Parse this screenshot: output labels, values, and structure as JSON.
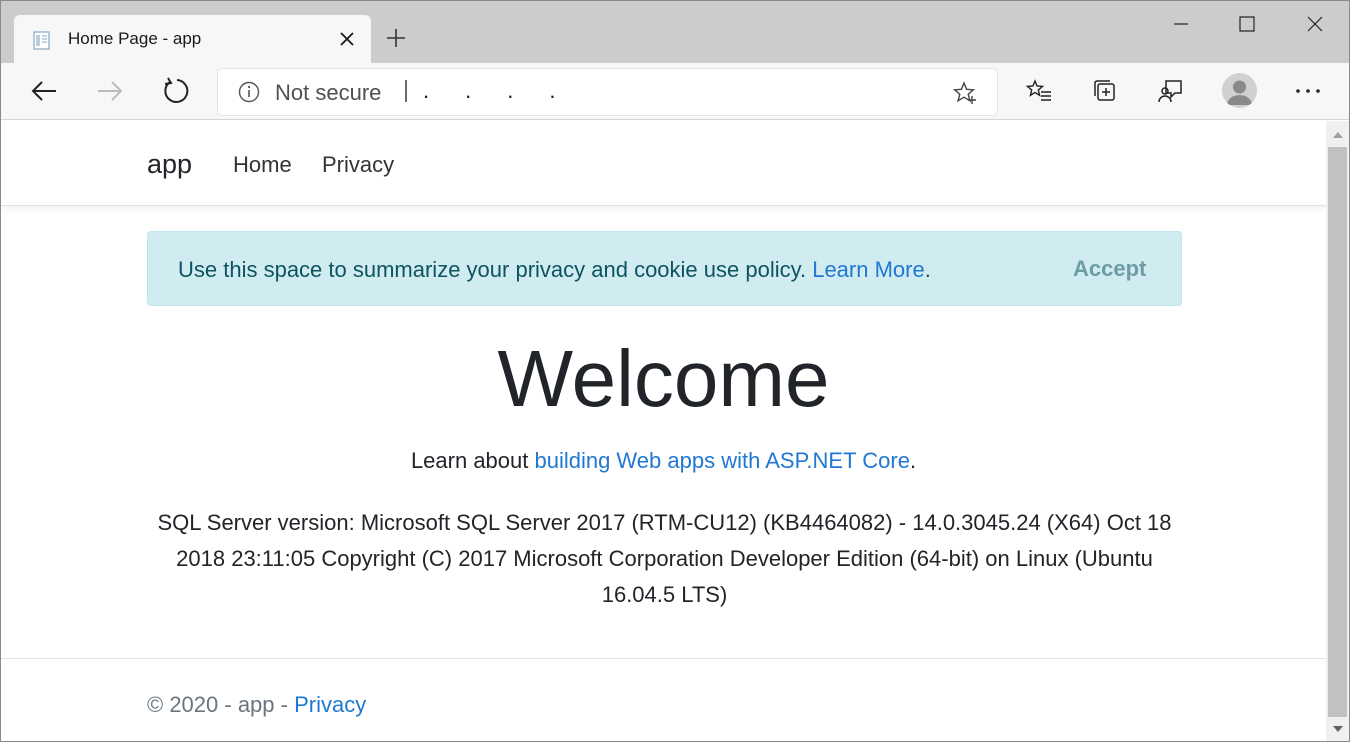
{
  "browser": {
    "tab": {
      "title": "Home Page - app"
    },
    "address_bar": {
      "security_status": "Not secure",
      "url": "...."
    }
  },
  "site": {
    "brand": "app",
    "nav": {
      "home": "Home",
      "privacy": "Privacy"
    },
    "cookie_alert": {
      "message": "Use this space to summarize your privacy and cookie use policy. ",
      "link": "Learn More",
      "suffix": ".",
      "accept": "Accept"
    },
    "welcome": "Welcome",
    "learn": {
      "prefix": "Learn about ",
      "link": "building Web apps with ASP.NET Core",
      "suffix": "."
    },
    "sql_version": "SQL Server version: Microsoft SQL Server 2017 (RTM-CU12) (KB4464082) - 14.0.3045.24 (X64) Oct 18 2018 23:11:05 Copyright (C) 2017 Microsoft Corporation Developer Edition (64-bit) on Linux (Ubuntu 16.04.5 LTS)",
    "footer": {
      "text": "© 2020 - app - ",
      "link": "Privacy"
    }
  },
  "colors": {
    "link": "#1f78d1",
    "alert_bg": "#d1ecf1",
    "alert_text": "#0c5460",
    "tabstrip": "#cccccc",
    "toolbar": "#f7f7f7"
  },
  "icons": {
    "tab_favicon": "page-icon",
    "tab_close": "close-icon",
    "new_tab": "plus-icon",
    "minimize": "minimize-icon",
    "maximize": "maximize-icon",
    "close_window": "close-icon",
    "back": "back-arrow-icon",
    "forward": "forward-arrow-icon",
    "refresh": "refresh-icon",
    "info": "info-icon",
    "favorite": "star-plus-icon",
    "favorites": "favorites-list-icon",
    "collections": "collections-icon",
    "feedback": "feedback-icon",
    "profile": "profile-avatar",
    "more": "more-icon"
  }
}
